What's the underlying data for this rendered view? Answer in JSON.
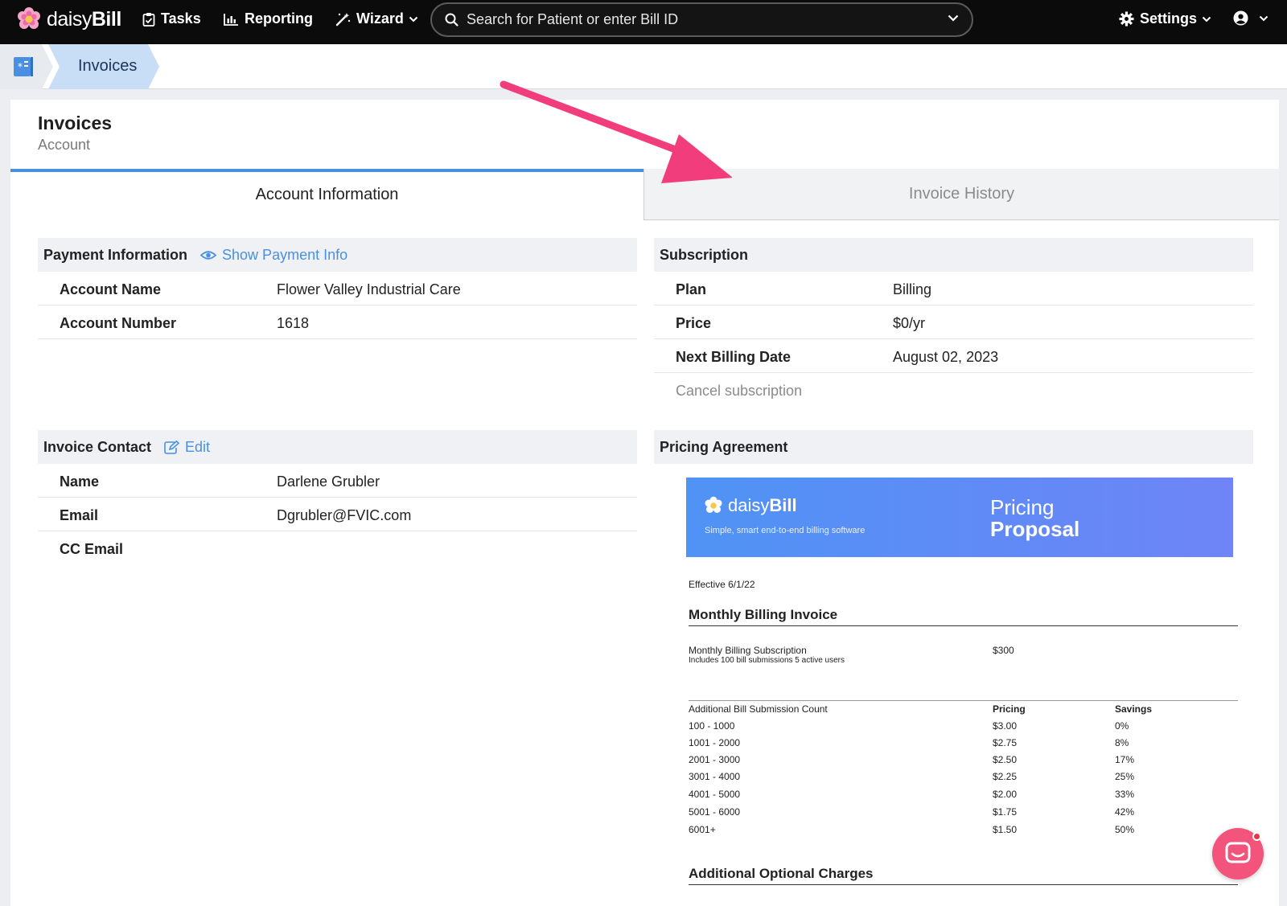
{
  "nav": {
    "brand_light": "daisy",
    "brand_bold": "Bill",
    "tasks": "Tasks",
    "reporting": "Reporting",
    "wizard": "Wizard",
    "search_placeholder": "Search for Patient or enter Bill ID",
    "settings": "Settings"
  },
  "breadcrumb": {
    "current": "Invoices"
  },
  "page": {
    "title": "Invoices",
    "subtitle": "Account"
  },
  "tabs": {
    "active": "Account Information",
    "inactive": "Invoice History"
  },
  "payment": {
    "heading": "Payment Information",
    "show_link": "Show Payment Info",
    "rows": [
      {
        "label": "Account Name",
        "value": "Flower Valley Industrial Care"
      },
      {
        "label": "Account Number",
        "value": "1618"
      }
    ]
  },
  "contact": {
    "heading": "Invoice Contact",
    "edit_link": "Edit",
    "rows": [
      {
        "label": "Name",
        "value": "Darlene Grubler"
      },
      {
        "label": "Email",
        "value": "Dgrubler@FVIC.com"
      },
      {
        "label": "CC Email",
        "value": ""
      }
    ]
  },
  "subscription": {
    "heading": "Subscription",
    "rows": [
      {
        "label": "Plan",
        "value": "Billing"
      },
      {
        "label": "Price",
        "value": "$0/yr"
      },
      {
        "label": "Next Billing Date",
        "value": "August 02, 2023"
      }
    ],
    "cancel": "Cancel subscription"
  },
  "pricing": {
    "heading": "Pricing Agreement",
    "doc": {
      "brand_light": "daisy",
      "brand_bold": "Bill",
      "tagline": "Simple, smart end-to-end billing software",
      "title_line1": "Pricing",
      "title_line2": "Proposal",
      "effective": "Effective 6/1/22",
      "monthly_heading": "Monthly Billing Invoice",
      "subscription_name": "Monthly Billing Subscription",
      "subscription_note": "Includes 100 bill submissions 5 active users",
      "subscription_price": "$300",
      "tier_header": [
        "Additional Bill Submission Count",
        "Pricing",
        "Savings"
      ],
      "tiers": [
        [
          "100 - 1000",
          "$3.00",
          "0%"
        ],
        [
          "1001 - 2000",
          "$2.75",
          "8%"
        ],
        [
          "2001 - 3000",
          "$2.50",
          "17%"
        ],
        [
          "3001 - 4000",
          "$2.25",
          "25%"
        ],
        [
          "4001 - 5000",
          "$2.00",
          "33%"
        ],
        [
          "5001 - 6000",
          "$1.75",
          "42%"
        ],
        [
          "6001+",
          "$1.50",
          "50%"
        ]
      ],
      "optional_heading": "Additional Optional Charges"
    }
  },
  "colors": {
    "accent": "#4a90e2",
    "annotation_arrow": "#f23d7d",
    "chat_bubble": "#f2547c"
  }
}
